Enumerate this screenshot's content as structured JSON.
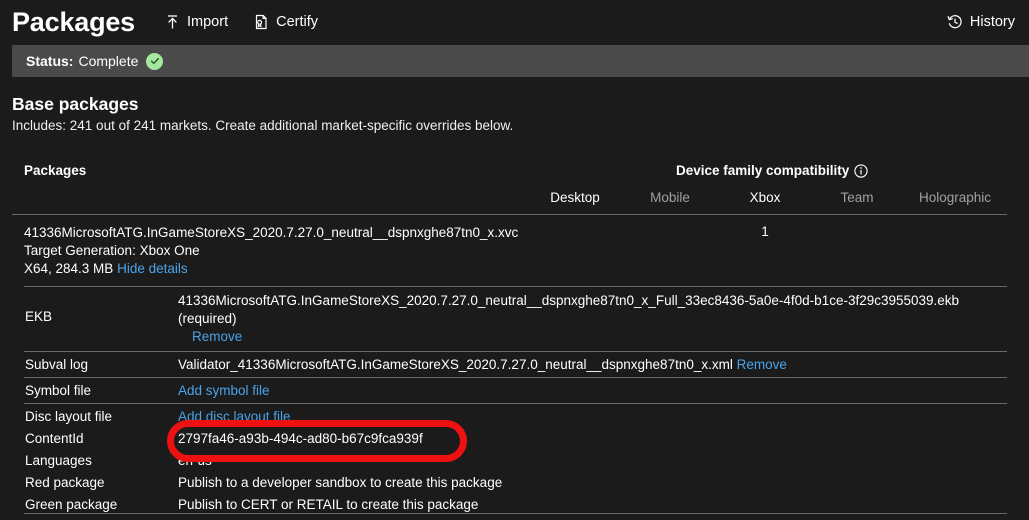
{
  "header": {
    "app_title": "Packages",
    "nav": [
      {
        "label": "Import",
        "icon": "upload-icon"
      },
      {
        "label": "Certify",
        "icon": "certificate-document-icon"
      }
    ],
    "history": {
      "label": "History",
      "icon": "history-clock-icon"
    }
  },
  "status": {
    "label": "Status:",
    "value": "Complete",
    "icon": "checkmark-circle-icon",
    "icon_color": "#a6e7a0",
    "bar_color": "#4a4a4a"
  },
  "section": {
    "title": "Base packages",
    "subtitle": "Includes: 241 out of 241 markets. Create additional market-specific overrides below."
  },
  "table": {
    "packages_header": "Packages",
    "device_family_header": "Device family compatibility",
    "device_family_info_icon": "info-circle-icon",
    "device_columns": [
      {
        "label": "Desktop",
        "active": true
      },
      {
        "label": "Mobile",
        "active": false
      },
      {
        "label": "Xbox",
        "active": true
      },
      {
        "label": "Team",
        "active": false
      },
      {
        "label": "Holographic",
        "active": false
      }
    ]
  },
  "package": {
    "filename": "41336MicrosoftATG.InGameStoreXS_2020.7.27.0_neutral__dspnxghe87tn0_x.xvc",
    "target_generation": "Target Generation: Xbox One",
    "arch_size": "X64, 284.3 MB",
    "hide_details_link": "Hide details",
    "device_counts": [
      "",
      "",
      "1",
      "",
      ""
    ]
  },
  "details": [
    {
      "label": "EKB",
      "value": "41336MicrosoftATG.InGameStoreXS_2020.7.27.0_neutral__dspnxghe87tn0_x_Full_33ec8436-5a0e-4f0d-b1ce-3f29c3955039.ekb",
      "required_note": "(required)",
      "link": "Remove"
    },
    {
      "label": "Subval log",
      "value": "Validator_41336MicrosoftATG.InGameStoreXS_2020.7.27.0_neutral__dspnxghe87tn0_x.xml",
      "link": "Remove"
    },
    {
      "label": "Symbol file",
      "value": "",
      "link": "Add symbol file"
    },
    {
      "label": "Disc layout file",
      "value": "",
      "link": "Add disc layout file"
    }
  ],
  "meta": [
    {
      "label": "ContentId",
      "value": "2797fa46-a93b-494c-ad80-b67c9fca939f"
    },
    {
      "label": "Languages",
      "value": "en-us"
    },
    {
      "label": "Red package",
      "value": "Publish to a developer sandbox to create this package"
    },
    {
      "label": "Green package",
      "value": "Publish to CERT or RETAIL to create this package"
    }
  ],
  "annotation": {
    "shape": "red-rounded-rect-highlight",
    "color": "#ee1111",
    "targets": "ContentId value"
  },
  "theme": {
    "background": "#1b1b1b",
    "link_color": "#4aa3e8",
    "rule_color": "#6a6a6a",
    "dim_text": "#a0a0a0"
  }
}
